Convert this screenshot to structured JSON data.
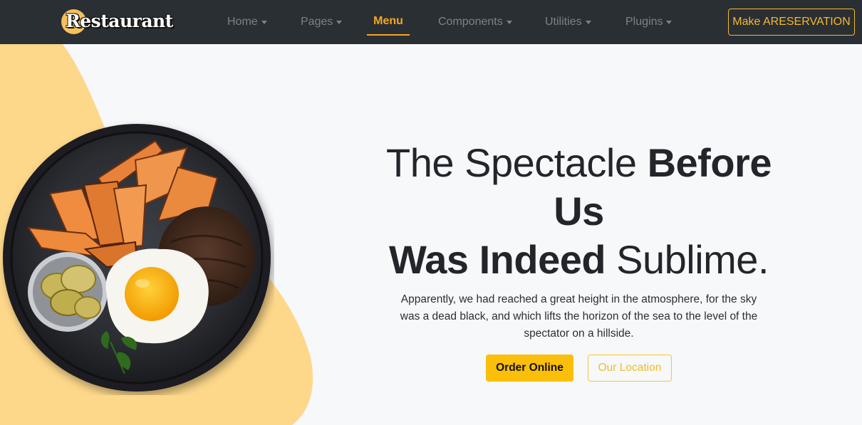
{
  "brand": {
    "name": "Restaurant"
  },
  "nav": {
    "items": [
      {
        "label": "Home",
        "has_caret": true
      },
      {
        "label": "Pages",
        "has_caret": true
      },
      {
        "label": "Menu",
        "has_caret": false,
        "active": true
      },
      {
        "label": "Components",
        "has_caret": true
      },
      {
        "label": "Utilities",
        "has_caret": true
      },
      {
        "label": "Plugins",
        "has_caret": true
      }
    ],
    "reserve_label": "Make ARESERVATION"
  },
  "hero": {
    "headline_line1_light": "The Spectacle ",
    "headline_line1_bold": "Before",
    "headline_line2_bold": "Us",
    "headline_line3_bold": "Was Indeed",
    "headline_line3_light": " Sublime.",
    "subtext": "Apparently, we had reached a great height in the atmosphere, for the sky was a dead black, and which lifts the horizon of the sea to the level of the spectator on a hillside.",
    "order_label": "Order Online",
    "location_label": "Our Location"
  },
  "colors": {
    "navbar_bg": "#2a2f33",
    "accent": "#f5a623",
    "primary_button": "#fbbf0a",
    "blob": "#fdd78a",
    "page_bg": "#f7f8fa"
  }
}
